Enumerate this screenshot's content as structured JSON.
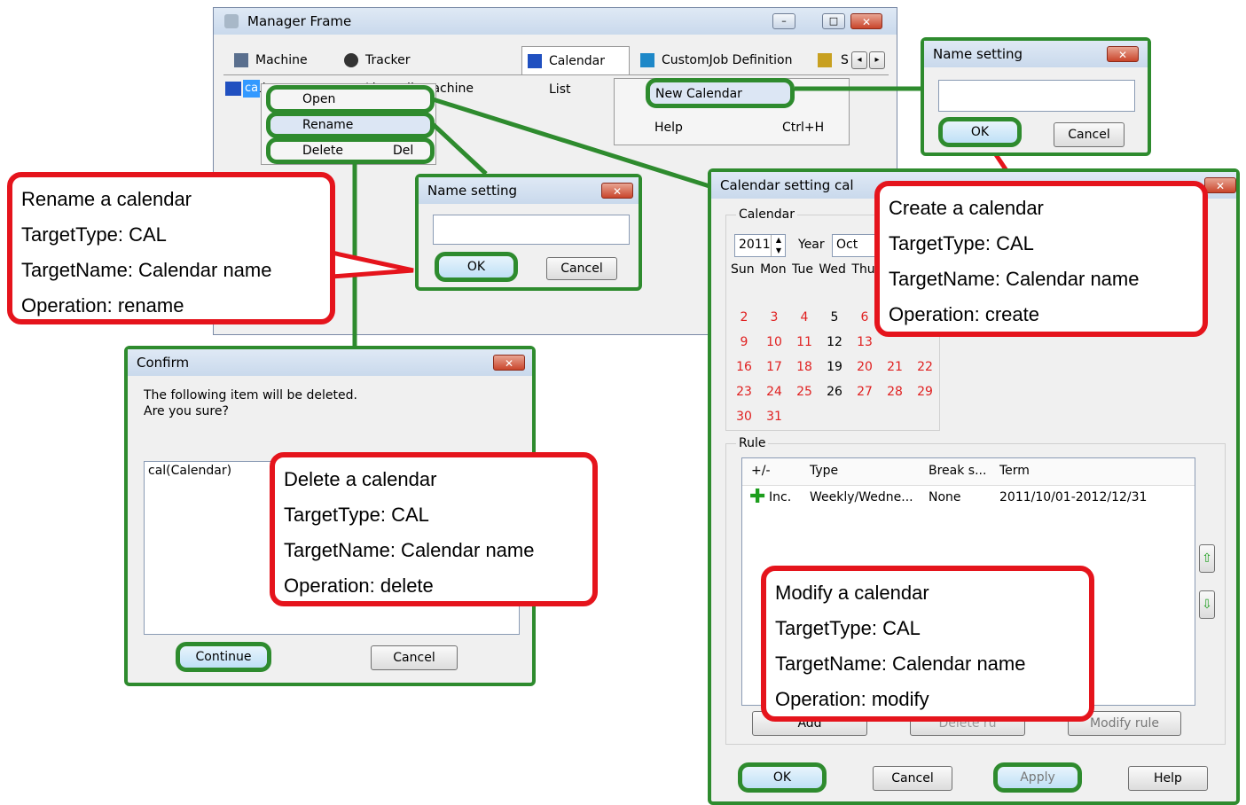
{
  "manager": {
    "title": "Manager Frame",
    "tabs": [
      "Machine List",
      "Tracker List@all_machine",
      "Calendar List",
      "CustomJob Definition List",
      "S"
    ],
    "tree_item": "ca"
  },
  "context_menu": {
    "open": "Open",
    "rename": "Rename",
    "delete": "Delete",
    "delete_shortcut": "Del"
  },
  "right_menu": {
    "new_calendar": "New Calendar",
    "help": "Help",
    "help_shortcut": "Ctrl+H"
  },
  "name_dialog_small": {
    "title": "Name setting",
    "ok": "OK",
    "cancel": "Cancel"
  },
  "name_dialog_top": {
    "title": "Name setting",
    "ok": "OK",
    "cancel": "Cancel"
  },
  "confirm": {
    "title": "Confirm",
    "line1": "The following item will be deleted.",
    "line2": "Are you sure?",
    "item": "cal(Calendar)",
    "continue": "Continue",
    "cancel": "Cancel"
  },
  "calendar_setting": {
    "title": "Calendar setting cal",
    "group_calendar": "Calendar",
    "year": "2011",
    "year_label": "Year",
    "month": "Oct",
    "weekdays": "Sun Mon Tue Wed Thu",
    "days_row1": [
      "2",
      "3",
      "4",
      "5",
      "6"
    ],
    "days_row2": [
      "9",
      "10",
      "11",
      "12",
      "13"
    ],
    "days_row3": [
      "16",
      "17",
      "18",
      "19",
      "20",
      "21",
      "22"
    ],
    "days_row4": [
      "23",
      "24",
      "25",
      "26",
      "27",
      "28",
      "29"
    ],
    "days_row5": [
      "30",
      "31"
    ],
    "rule_label": "Rule",
    "rule_headers": [
      "+/-",
      "Type",
      "Break s...",
      "Term"
    ],
    "rule_row": [
      "Inc.",
      "Weekly/Wedne...",
      "None",
      "2011/10/01-2012/12/31"
    ],
    "add_rule": "Add",
    "delete_rule": "Delete ru",
    "modify_rule": "Modify rule",
    "ok": "OK",
    "cancel": "Cancel",
    "apply": "Apply",
    "help": "Help"
  },
  "callouts": {
    "rename": [
      "Rename a calendar",
      "TargetType: CAL",
      "TargetName: Calendar name",
      "Operation: rename"
    ],
    "create": [
      "Create a calendar",
      "TargetType: CAL",
      "TargetName: Calendar name",
      "Operation: create"
    ],
    "delete": [
      "Delete a calendar",
      "TargetType: CAL",
      "TargetName: Calendar name",
      "Operation: delete"
    ],
    "modify": [
      "Modify a calendar",
      "TargetType: CAL",
      "TargetName: Calendar name",
      "Operation: modify"
    ]
  },
  "colors": {
    "highlight_green": "#2e8b2e",
    "callout_red": "#e5141c",
    "weekend_red": "#e02020"
  }
}
